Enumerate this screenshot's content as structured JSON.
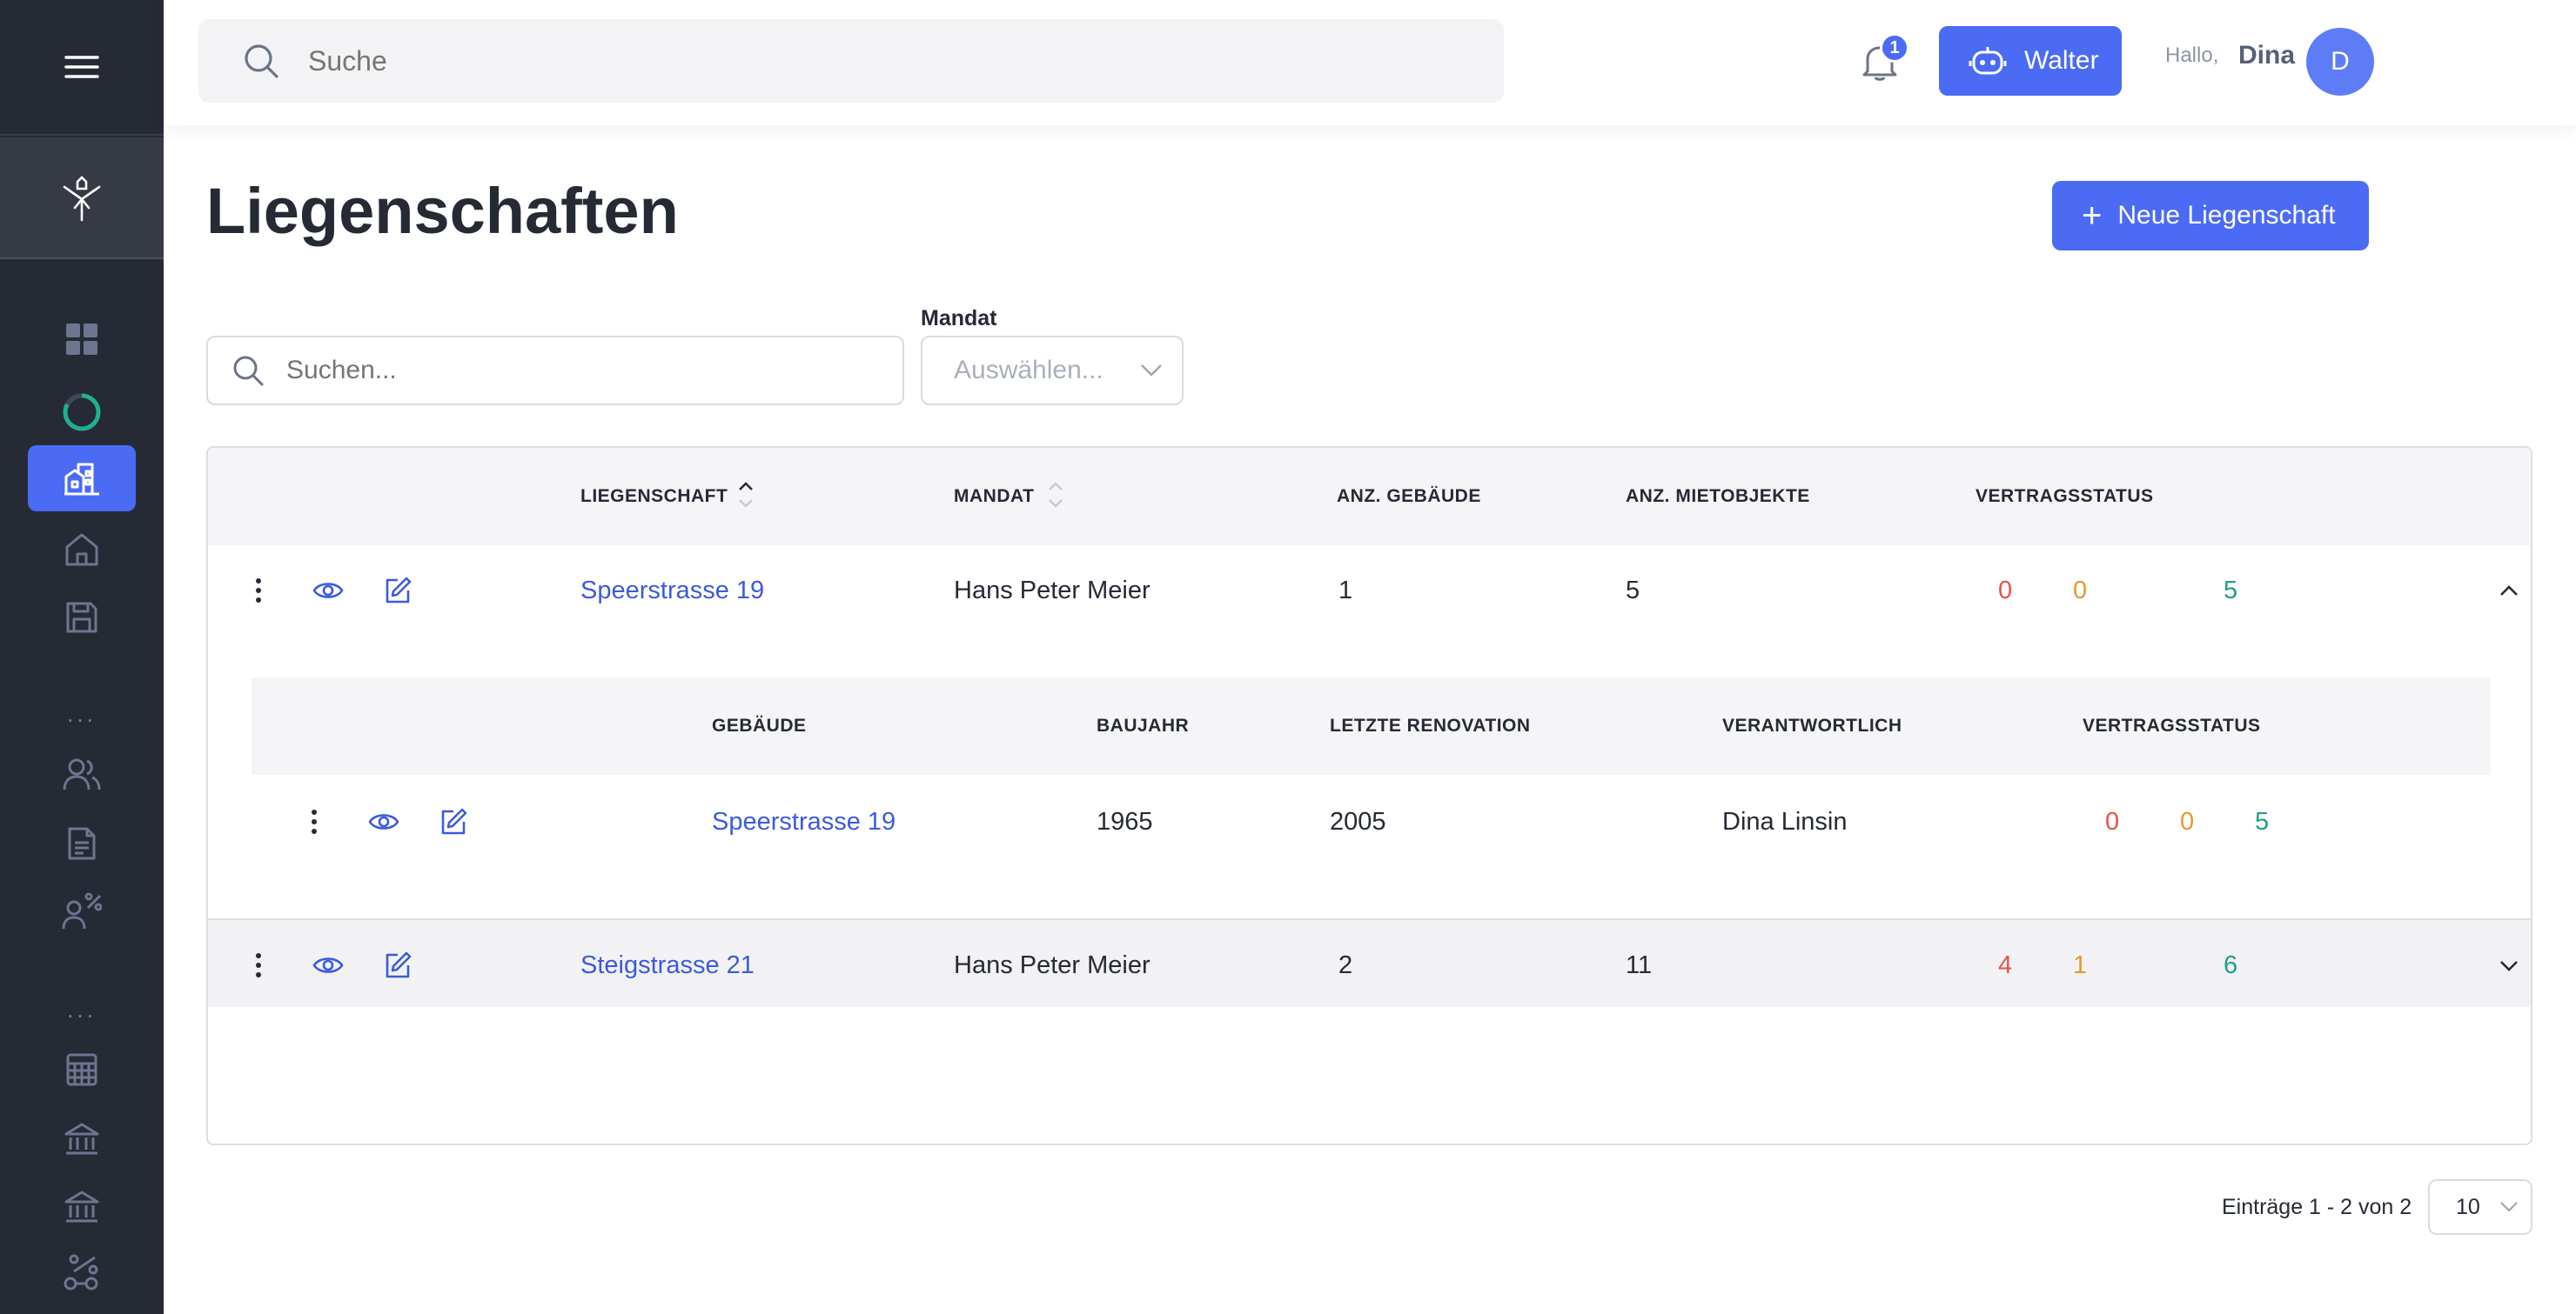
{
  "header": {
    "search_placeholder": "Suche",
    "notifications_count": "1",
    "assistant_label": "Walter",
    "greeting": "Hallo,",
    "user_name": "Dina",
    "avatar_initial": "D"
  },
  "sidebar": {
    "icons": [
      "menu-icon",
      "logo-icon",
      "dashboard-icon",
      "progress-icon",
      "properties-icon",
      "home-icon",
      "save-icon",
      "people-icon",
      "document-icon",
      "user-percent-icon",
      "calculator-icon",
      "bank-icon",
      "bank-icon",
      "percent-chart-icon"
    ],
    "separator": "..."
  },
  "page": {
    "title": "Liegenschaften",
    "new_button": "Neue Liegenschaft",
    "filter_search_placeholder": "Suchen...",
    "mandat_label": "Mandat",
    "mandat_placeholder": "Auswählen..."
  },
  "table": {
    "columns": [
      "LIEGENSCHAFT",
      "MANDAT",
      "ANZ. GEBÄUDE",
      "ANZ. MIETOBJEKTE",
      "VERTRAGSSTATUS"
    ],
    "rows": [
      {
        "liegenschaft": "Speerstrasse 19",
        "mandat": "Hans Peter Meier",
        "gebaeude": "1",
        "mietobjekte": "5",
        "status": [
          "0",
          "0",
          "5"
        ],
        "expanded": true,
        "sub_columns": [
          "GEBÄUDE",
          "BAUJAHR",
          "LETZTE RENOVATION",
          "VERANTWORTLICH",
          "VERTRAGSSTATUS"
        ],
        "sub_rows": [
          {
            "gebaeude": "Speerstrasse 19",
            "baujahr": "1965",
            "renovation": "2005",
            "verantwortlich": "Dina Linsin",
            "status": [
              "0",
              "0",
              "5"
            ]
          }
        ]
      },
      {
        "liegenschaft": "Steigstrasse 21",
        "mandat": "Hans Peter Meier",
        "gebaeude": "2",
        "mietobjekte": "11",
        "status": [
          "4",
          "1",
          "6"
        ],
        "expanded": false
      }
    ]
  },
  "footer": {
    "entries_text": "Einträge 1 - 2 von 2",
    "per_page": "10"
  },
  "colors": {
    "accent": "#4b6bf5",
    "sidebar_bg": "#262a35",
    "status_red": "#e5524b",
    "status_orange": "#e49a2a",
    "status_green": "#1e9f86",
    "link": "#3d5bd9"
  }
}
